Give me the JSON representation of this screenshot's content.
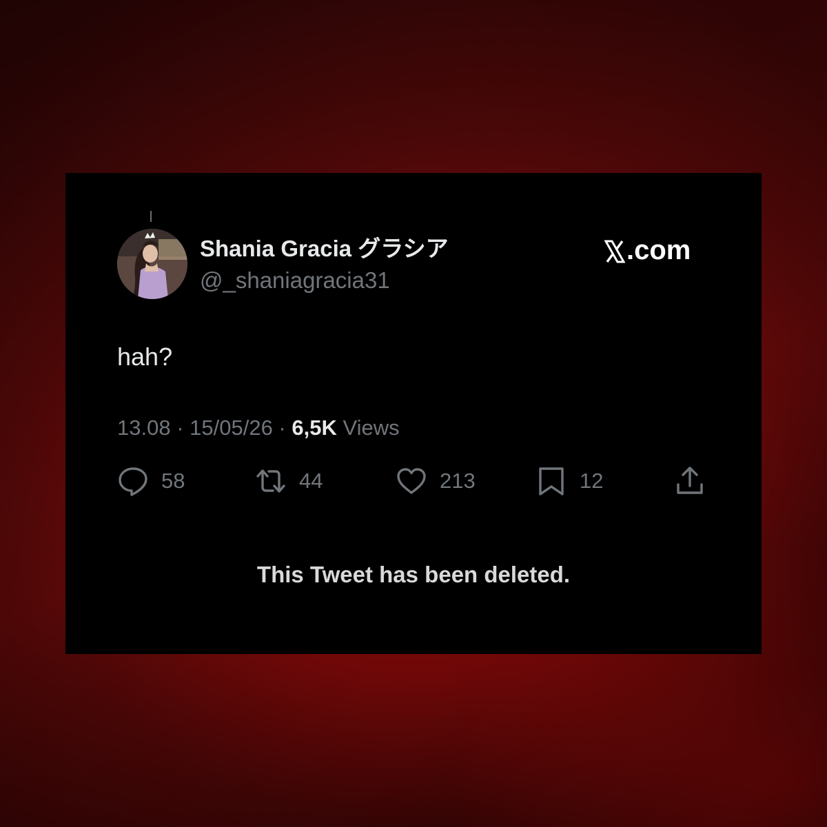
{
  "colors": {
    "card_background": "#000000",
    "primary_text": "#e7e9ea",
    "secondary_text": "#71767b",
    "page_background": "#6e0a0a"
  },
  "tweet": {
    "display_name": "Shania Gracia グラシア",
    "handle": "@_shaniagracia31",
    "brand": ".com",
    "brand_icon": "x-logo-icon",
    "text": "hah?",
    "time": "13.08",
    "date": "15/05/26",
    "separator": " · ",
    "views_count": "6,5K",
    "views_label": "Views"
  },
  "actions": {
    "replies": {
      "icon": "reply-icon",
      "count": "58"
    },
    "retweets": {
      "icon": "retweet-icon",
      "count": "44"
    },
    "likes": {
      "icon": "heart-icon",
      "count": "213"
    },
    "bookmarks": {
      "icon": "bookmark-icon",
      "count": "12"
    },
    "share": {
      "icon": "share-icon"
    }
  },
  "notice": {
    "deleted_text": "This Tweet has been deleted."
  }
}
